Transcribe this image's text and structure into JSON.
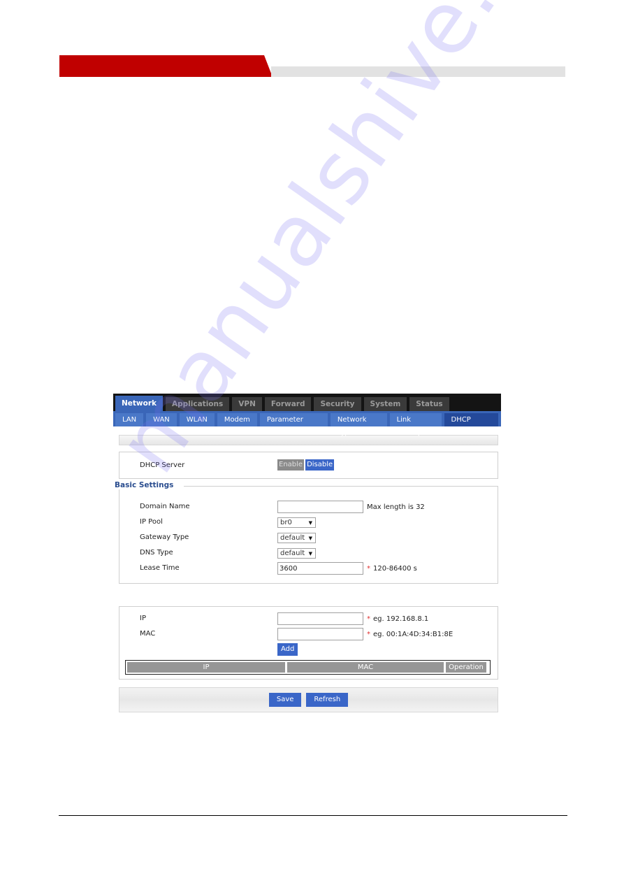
{
  "colors": {
    "header_red": "#c00000",
    "header_gray": "#e2e2e2",
    "tab_active_blue": "#3a66b8",
    "subtab_active_blue": "#24499a",
    "button_blue": "#3a66c8",
    "button_gray": "#8a8a8a",
    "legend_text": "#2a4d8f",
    "required_star": "#e03030"
  },
  "watermark": "manualshive.com",
  "main_tabs": [
    {
      "label": "Network",
      "active": true
    },
    {
      "label": "Applications",
      "active": false
    },
    {
      "label": "VPN",
      "active": false
    },
    {
      "label": "Forward",
      "active": false
    },
    {
      "label": "Security",
      "active": false
    },
    {
      "label": "System",
      "active": false
    },
    {
      "label": "Status",
      "active": false
    }
  ],
  "sub_tabs": [
    {
      "label": "LAN",
      "active": false
    },
    {
      "label": "WAN",
      "active": false
    },
    {
      "label": "WLAN",
      "active": false
    },
    {
      "label": "Modem",
      "active": false
    },
    {
      "label": "Parameter Select",
      "active": false
    },
    {
      "label": "Network Type",
      "active": false
    },
    {
      "label": "Link Backup",
      "active": false
    },
    {
      "label": "DHCP Server",
      "active": true
    }
  ],
  "dhcp": {
    "label": "DHCP Server",
    "enable_label": "Enable",
    "disable_label": "Disable",
    "state": "Disable"
  },
  "basic_settings": {
    "legend": "Basic Settings",
    "domain_name": {
      "label": "Domain Name",
      "value": "",
      "hint": "Max length is 32"
    },
    "ip_pool": {
      "label": "IP Pool",
      "selected": "br0"
    },
    "gateway_type": {
      "label": "Gateway Type",
      "selected": "default"
    },
    "dns_type": {
      "label": "DNS Type",
      "selected": "default"
    },
    "lease_time": {
      "label": "Lease Time",
      "value": "3600",
      "required": "*",
      "hint": "120-86400 s"
    }
  },
  "static": {
    "ip": {
      "label": "IP",
      "value": "",
      "required": "*",
      "hint": "eg. 192.168.8.1"
    },
    "mac": {
      "label": "MAC",
      "value": "",
      "required": "*",
      "hint": "eg. 00:1A:4D:34:B1:8E"
    },
    "add_label": "Add",
    "table_headers": [
      "IP",
      "MAC",
      "Operation"
    ],
    "rows": []
  },
  "footer": {
    "save_label": "Save",
    "refresh_label": "Refresh"
  }
}
